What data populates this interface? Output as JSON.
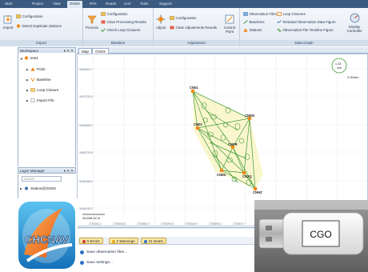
{
  "menubar": {
    "tabs": [
      "Start",
      "Project",
      "View",
      "GNSS",
      "RTK",
      "Roads",
      "UAV",
      "Tools",
      "Support"
    ],
    "active": "GNSS"
  },
  "ribbon": {
    "import_group": {
      "title": "Import",
      "import_label": "Import",
      "configuration": "Configuration",
      "detect_duplicate": "Detect Duplicate Stations"
    },
    "baseline_group": {
      "title": "Baseline",
      "process_label": "Process",
      "configuration": "Configuration",
      "clear_processing": "Clear Processing Results",
      "check_loop": "Check Loop Closures"
    },
    "adjustment_group": {
      "title": "Adjustment",
      "adjust_label": "Adjust",
      "configuration": "Configuration",
      "clear_adjustments": "Clear Adjustments Results",
      "control_point": "Control Point"
    },
    "datagraph_group": {
      "title": "Data Graph",
      "observation_files": "Observation Files",
      "baselines": "Baselines",
      "stations": "Stations",
      "loop_closures": "Loop Closures",
      "residual_figure": "Residual Observation Data Figure",
      "timeline_figure": "Observation File Timeline Figure",
      "display_controller": "Display Controller"
    }
  },
  "workspace": {
    "title": "Workspace",
    "controls": "▾ ✕ ✕",
    "root": "test1",
    "items": [
      "Point",
      "Baseline",
      "Loop Closure",
      "Import File"
    ]
  },
  "layers": {
    "title": "Layer Manager",
    "controls": "▾ ✕ ✕",
    "search_placeholder": "Search",
    "station_item": "Station@GNSS"
  },
  "map": {
    "tabs": [
      "Map",
      "GNSS"
    ],
    "scale_top": "1.33",
    "scale_unit": "mm",
    "scale_label": "2.00mm",
    "y_ticks": [
      "3448481.7",
      "3447233.4",
      "3446985.2",
      "3446734.8",
      "3446486.5",
      "3446240.2"
    ],
    "x_ticks": [
      "2782351.2",
      "2782600.6",
      "2782850.0",
      "2783099.5",
      "2783348.9",
      "2783598.3",
      "2783847.7",
      "2784097.1",
      "2784346.5"
    ],
    "coord_readout": "26,838.32 m",
    "stations": [
      "CN01",
      "CN02",
      "CNDN",
      "CNFR",
      "CN0D",
      "CN2Q",
      "CNHZ"
    ]
  },
  "messages": {
    "title": "Message",
    "errors": "0 Errors",
    "warnings": "2 Warnings",
    "notes": "41 Notes",
    "rows": [
      "Save observation files...",
      "Save settings..."
    ]
  },
  "logo": {
    "text": "CHCNAV"
  },
  "dongle": {
    "label": "CGO"
  },
  "colors": {
    "menubar": "#3b5a80",
    "accent_orange": "#f08a1c",
    "network_green": "#3f9a35",
    "error_red": "#d23a2a",
    "warning_amber": "#e9a51a"
  }
}
